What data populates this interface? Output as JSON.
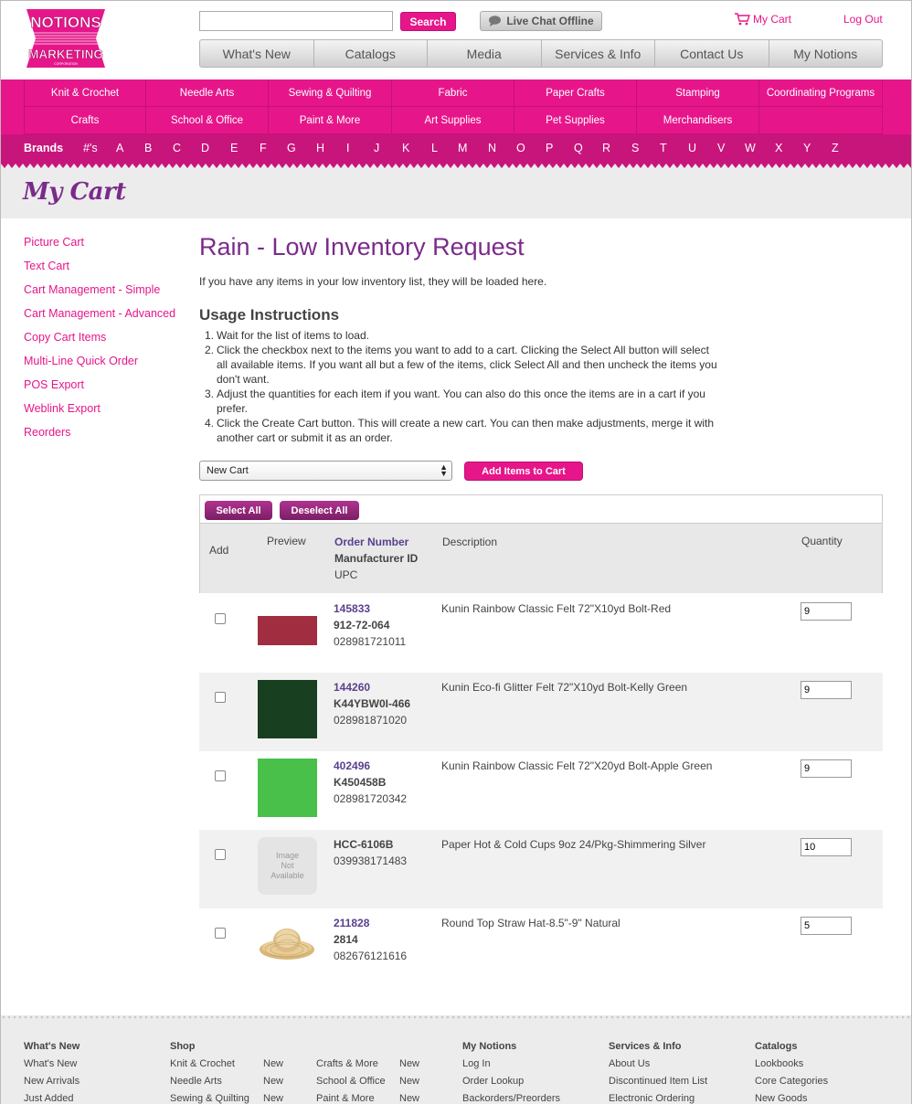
{
  "header": {
    "logo_text_top": "NOTIONS",
    "logo_text_bottom": "MARKETING",
    "logo_text_sub": "CORPORATION",
    "search_placeholder": "",
    "search_label": "Search",
    "chat_label": "Live Chat Offline",
    "mycart_label": "My Cart",
    "logout_label": "Log Out"
  },
  "topnav": [
    "What's New",
    "Catalogs",
    "Media",
    "Services & Info",
    "Contact Us",
    "My Notions"
  ],
  "categories_row1": [
    "Knit & Crochet",
    "Needle Arts",
    "Sewing & Quilting",
    "Fabric",
    "Paper Crafts",
    "Stamping",
    "Coordinating Programs"
  ],
  "categories_row2": [
    "Crafts",
    "School & Office",
    "Paint & More",
    "Art Supplies",
    "Pet Supplies",
    "Merchandisers",
    ""
  ],
  "brands": {
    "label": "Brands",
    "letters": [
      "#'s",
      "A",
      "B",
      "C",
      "D",
      "E",
      "F",
      "G",
      "H",
      "I",
      "J",
      "K",
      "L",
      "M",
      "N",
      "O",
      "P",
      "Q",
      "R",
      "S",
      "T",
      "U",
      "V",
      "W",
      "X",
      "Y",
      "Z"
    ]
  },
  "page_header_title": "My Cart",
  "sidebar": [
    "Picture Cart",
    "Text Cart",
    "Cart Management - Simple",
    "Cart Management - Advanced",
    "Copy Cart Items",
    "Multi-Line Quick Order",
    "POS Export",
    "Weblink Export",
    "Reorders"
  ],
  "main": {
    "title": "Rain - Low Inventory Request",
    "intro": "If you have any items in your low inventory list, they will be loaded here.",
    "usage_title": "Usage Instructions",
    "steps": [
      [
        "1.",
        "Wait for the list of items to load."
      ],
      [
        "2.",
        "Click the checkbox next to the items you want to add to a cart. Clicking the Select All button will select all available items. If you want all but a few of the items, click Select All and then uncheck the items you don't want."
      ],
      [
        "3.",
        "Adjust the quantities for each item if you want. You can also do this once the items are in a cart if you prefer."
      ],
      [
        "4.",
        "Click the Create Cart button. This will create a new cart. You can then make adjustments, merge it with another cart or submit it as an order."
      ]
    ],
    "cart_select_value": "New Cart",
    "add_items_label": "Add Items to Cart",
    "select_all_label": "Select All",
    "deselect_all_label": "Deselect All"
  },
  "table": {
    "headers": {
      "add": "Add",
      "preview": "Preview",
      "order_number": "Order Number",
      "manufacturer_id": "Manufacturer ID",
      "upc": "UPC",
      "description": "Description",
      "quantity": "Quantity"
    },
    "rows": [
      {
        "order": "145833",
        "mfr": "912-72-064",
        "upc": "028981721011",
        "desc": "Kunin Rainbow Classic Felt 72\"X10yd Bolt-Red",
        "qty": "9",
        "preview_color": "#a12d41"
      },
      {
        "order": "144260",
        "mfr": "K44YBW0I-466",
        "upc": "028981871020",
        "desc": "Kunin Eco-fi Glitter Felt 72\"X10yd Bolt-Kelly Green",
        "qty": "9",
        "preview_color": "#173f20"
      },
      {
        "order": "402496",
        "mfr": "K450458B",
        "upc": "028981720342",
        "desc": "Kunin Rainbow Classic Felt 72\"X20yd Bolt-Apple Green",
        "qty": "9",
        "preview_color": "#48c04a"
      },
      {
        "order": "",
        "mfr": "HCC-6106B",
        "upc": "039938171483",
        "desc": "Paper Hot & Cold Cups 9oz 24/Pkg-Shimmering Silver",
        "qty": "10",
        "preview_text": "Image Not Available"
      },
      {
        "order": "211828",
        "mfr": "2814",
        "upc": "082676121616",
        "desc": "Round Top Straw Hat-8.5\"-9\" Natural",
        "qty": "5",
        "preview_icon": "straw-hat-icon"
      }
    ]
  },
  "footer": {
    "cols": [
      {
        "h": "What's New",
        "links": [
          "What's New",
          "New Arrivals",
          "Just Added"
        ]
      },
      {
        "h": "Shop",
        "links": [
          "Knit & Crochet",
          "Needle Arts",
          "Sewing & Quilting"
        ]
      },
      {
        "h": "",
        "links": [
          "New",
          "New",
          "New"
        ]
      },
      {
        "h": "",
        "links": [
          "Crafts & More",
          "School & Office",
          "Paint & More"
        ]
      },
      {
        "h": "",
        "links": [
          "New",
          "New",
          "New"
        ]
      },
      {
        "h": "My Notions",
        "links": [
          "Log In",
          "Order Lookup",
          "Backorders/Preorders"
        ]
      },
      {
        "h": "Services & Info",
        "links": [
          "About Us",
          "Discontinued Item List",
          "Electronic Ordering"
        ]
      },
      {
        "h": "Catalogs",
        "links": [
          "Lookbooks",
          "Core Categories",
          "New Goods"
        ]
      }
    ]
  },
  "colors": {
    "accent": "#e6168a",
    "purple": "#7a2b8a",
    "brands_bar": "#c8157c"
  }
}
